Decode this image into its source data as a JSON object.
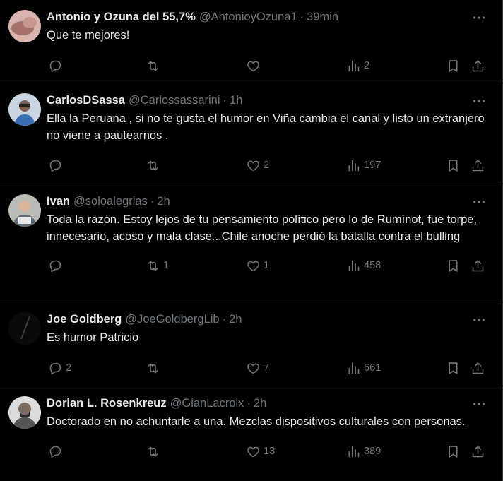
{
  "tweets": [
    {
      "name": "Antonio y Ozuna del 55,7%",
      "handle": "@AntonioyOzuna1",
      "time": "39min",
      "text": "Que te mejores!",
      "replies": "",
      "retweets": "",
      "likes": "",
      "views": "2",
      "avatar_color": "#b98a86"
    },
    {
      "name": "CarlosDSassa",
      "handle": "@Carlossassarini",
      "time": "1h",
      "text": "Ella la Peruana , si no te gusta el humor en Viña cambia el canal y listo un extranjero no viene a pautearnos .",
      "replies": "",
      "retweets": "",
      "likes": "2",
      "views": "197",
      "avatar_color": "#9bb7d4"
    },
    {
      "name": "Ivan",
      "handle": "@soloalegrias",
      "time": "2h",
      "text": "Toda la razón. Estoy lejos de tu pensamiento político pero lo de Rumínot, fue torpe, innecesario, acoso y mala clase...Chile anoche perdió la batalla contra el bulling",
      "replies": "",
      "retweets": "1",
      "likes": "1",
      "views": "458",
      "avatar_color": "#8a8f8a"
    },
    {
      "name": "Joe Goldberg",
      "handle": "@JoeGoldbergLib",
      "time": "2h",
      "text": "Es humor Patricio",
      "replies": "2",
      "retweets": "",
      "likes": "7",
      "views": "661",
      "avatar_color": "#111111"
    },
    {
      "name": "Dorian L. Rosenkreuz",
      "handle": "@GianLacroix",
      "time": "2h",
      "text": "Doctorado en no achuntarle a una. Mezclas dispositivos culturales con personas.",
      "replies": "",
      "retweets": "",
      "likes": "13",
      "views": "389",
      "avatar_color": "#cfcfcf"
    }
  ],
  "icons": {
    "reply": "reply-icon",
    "retweet": "retweet-icon",
    "like": "like-icon",
    "views": "views-icon",
    "bookmark": "bookmark-icon",
    "share": "share-icon",
    "more": "more-icon"
  }
}
